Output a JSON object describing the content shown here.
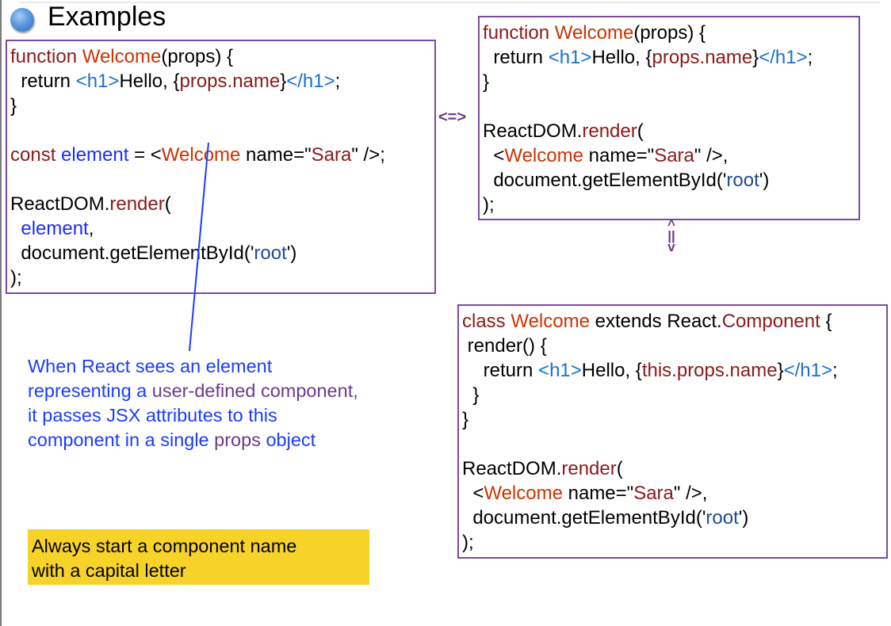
{
  "slide": {
    "title": "Examples"
  },
  "colors": {
    "kw": "#8b1a1a",
    "comp": "#cc3300",
    "tag": "#1a6fd0",
    "var": "#1a2cff",
    "str": "#1f4e8c",
    "plain": "#000000",
    "border": "#7b4aa0",
    "note": "#1a3cff",
    "highlight": "#f7d32a"
  },
  "code_left": [
    [
      [
        "function ",
        "kw"
      ],
      [
        "Welcome",
        "comp"
      ],
      [
        "(props) {",
        "plain"
      ]
    ],
    [
      [
        "  return ",
        "plain"
      ],
      [
        "<h1>",
        "tag"
      ],
      [
        "Hello, {",
        "plain"
      ],
      [
        "props.name",
        "kw"
      ],
      [
        "}",
        "plain"
      ],
      [
        "</h1>",
        "tag"
      ],
      [
        ";",
        "plain"
      ]
    ],
    [
      [
        "}",
        "plain"
      ]
    ],
    [],
    [
      [
        "const ",
        "kw"
      ],
      [
        "element",
        "var"
      ],
      [
        " = <",
        "plain"
      ],
      [
        "Welcome",
        "comp"
      ],
      [
        " name=\"",
        "plain"
      ],
      [
        "Sara",
        "kw"
      ],
      [
        "\" />;",
        "plain"
      ]
    ],
    [],
    [
      [
        "ReactDOM.",
        "plain"
      ],
      [
        "render",
        "kw"
      ],
      [
        "(",
        "plain"
      ]
    ],
    [
      [
        "  ",
        "plain"
      ],
      [
        "element",
        "var"
      ],
      [
        ",",
        "plain"
      ]
    ],
    [
      [
        "  document.getElementById('",
        "plain"
      ],
      [
        "root",
        "str"
      ],
      [
        "')",
        "plain"
      ]
    ],
    [
      [
        ");",
        "plain"
      ]
    ]
  ],
  "code_right_top": [
    [
      [
        "function ",
        "kw"
      ],
      [
        "Welcome",
        "comp"
      ],
      [
        "(props) {",
        "plain"
      ]
    ],
    [
      [
        "  return ",
        "plain"
      ],
      [
        "<h1>",
        "tag"
      ],
      [
        "Hello, {",
        "plain"
      ],
      [
        "props.name",
        "kw"
      ],
      [
        "}",
        "plain"
      ],
      [
        "</h1>",
        "tag"
      ],
      [
        ";",
        "plain"
      ]
    ],
    [
      [
        "}",
        "plain"
      ]
    ],
    [],
    [
      [
        "ReactDOM.",
        "plain"
      ],
      [
        "render",
        "kw"
      ],
      [
        "(",
        "plain"
      ]
    ],
    [
      [
        "  <",
        "plain"
      ],
      [
        "Welcome",
        "comp"
      ],
      [
        " name=\"",
        "plain"
      ],
      [
        "Sara",
        "kw"
      ],
      [
        "\" />,",
        "plain"
      ]
    ],
    [
      [
        "  document.getElementById('",
        "plain"
      ],
      [
        "root",
        "str"
      ],
      [
        "')",
        "plain"
      ]
    ],
    [
      [
        ");",
        "plain"
      ]
    ]
  ],
  "code_right_bottom": [
    [
      [
        "class ",
        "kw"
      ],
      [
        "Welcome",
        "comp"
      ],
      [
        " extends React.",
        "plain"
      ],
      [
        "Component",
        "kw"
      ],
      [
        " {",
        "plain"
      ]
    ],
    [
      [
        " render() {",
        "plain"
      ]
    ],
    [
      [
        "    return ",
        "plain"
      ],
      [
        "<h1>",
        "tag"
      ],
      [
        "Hello, {",
        "plain"
      ],
      [
        "this.props.name",
        "kw"
      ],
      [
        "}",
        "plain"
      ],
      [
        "</h1>",
        "tag"
      ],
      [
        ";",
        "plain"
      ]
    ],
    [
      [
        "  }",
        "plain"
      ]
    ],
    [
      [
        "}",
        "plain"
      ]
    ],
    [],
    [
      [
        "ReactDOM.",
        "plain"
      ],
      [
        "render",
        "kw"
      ],
      [
        "(",
        "plain"
      ]
    ],
    [
      [
        "  <",
        "plain"
      ],
      [
        "Welcome",
        "comp"
      ],
      [
        " name=\"",
        "plain"
      ],
      [
        "Sara",
        "kw"
      ],
      [
        "\" />,",
        "plain"
      ]
    ],
    [
      [
        "  document.getElementById('",
        "plain"
      ],
      [
        "root",
        "str"
      ],
      [
        "')",
        "plain"
      ]
    ],
    [
      [
        ");",
        "plain"
      ]
    ]
  ],
  "equiv_horizontal": "<=>",
  "equiv_vertical": [
    "^",
    "||",
    "v"
  ],
  "note": {
    "line1": "When React sees an element",
    "line2a": "representing a ",
    "line2b": "user-defined component,",
    "line3": "it passes JSX attributes to this",
    "line4a": "component in a single ",
    "line4b": "props",
    "line4c": " object"
  },
  "tip": {
    "line1": "Always start a component name",
    "line2": "with a capital letter"
  }
}
